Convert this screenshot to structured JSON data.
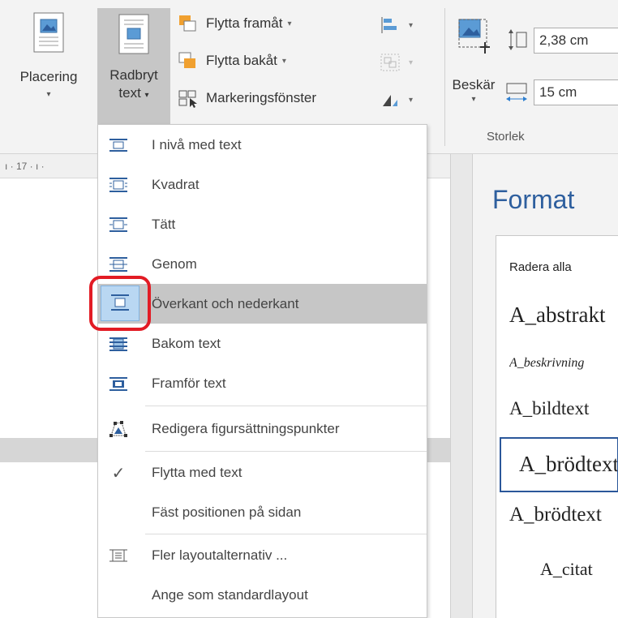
{
  "ribbon": {
    "placering": {
      "line1": "Placering",
      "caret": "▾"
    },
    "radbryt": {
      "line1": "Radbryt",
      "line2": "text",
      "caret": "▾"
    },
    "flytta_framat": "Flytta framåt",
    "flytta_bakat": "Flytta bakåt",
    "markeringsfonster": "Markeringsfönster",
    "beskar": {
      "label": "Beskär",
      "caret": "▾"
    },
    "height_value": "2,38 cm",
    "width_value": "15 cm",
    "group_storlek": "Storlek",
    "small_caret": "▾"
  },
  "ruler": {
    "text": "ı · 17 · ı ·"
  },
  "menu": {
    "items": [
      {
        "label": "I nivå med text",
        "icon": "inline-with-text-icon"
      },
      {
        "label": "Kvadrat",
        "icon": "square-wrap-icon"
      },
      {
        "label": "Tätt",
        "icon": "tight-wrap-icon"
      },
      {
        "label": "Genom",
        "icon": "through-wrap-icon"
      },
      {
        "label": "Överkant och nederkant",
        "icon": "top-bottom-wrap-icon"
      },
      {
        "label": "Bakom text",
        "icon": "behind-text-icon"
      },
      {
        "label": "Framför text",
        "icon": "in-front-of-text-icon"
      },
      {
        "label": "Redigera figursättningspunkter",
        "icon": "edit-wrap-points-icon"
      },
      {
        "label": "Flytta med text",
        "icon": "checkmark-icon",
        "check": "✓"
      },
      {
        "label": "Fäst positionen på sidan",
        "icon": ""
      },
      {
        "label": "Fler layoutalternativ ...",
        "icon": "more-layout-icon"
      },
      {
        "label": "Ange som standardlayout",
        "icon": ""
      }
    ]
  },
  "pane": {
    "title": "Format",
    "styles": [
      "Radera alla",
      "A_abstrakt",
      "A_beskrivning",
      "A_bildtext",
      "A_brödtext",
      "A_brödtext",
      "A_citat"
    ]
  },
  "colors": {
    "accent_blue": "#2e5f9e",
    "highlight": "#c6c6c6",
    "annotation_red": "#e21b24"
  }
}
